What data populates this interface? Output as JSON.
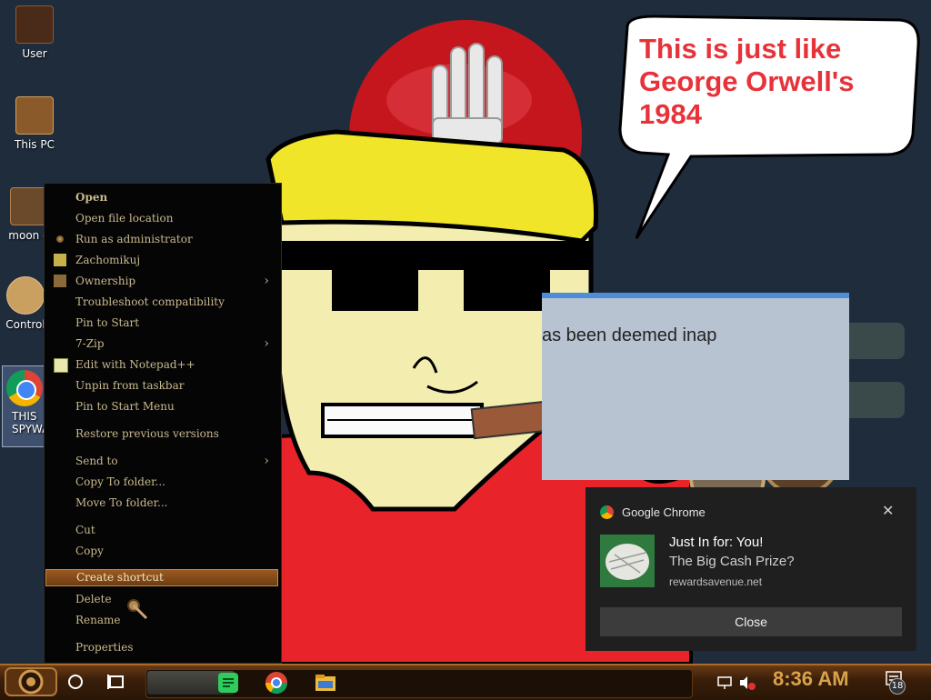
{
  "desktop": {
    "icons": [
      {
        "label": "User"
      },
      {
        "label": "This PC"
      },
      {
        "label": "moon g"
      },
      {
        "label": "Control"
      },
      {
        "label": "THIS\nSPYWA"
      }
    ]
  },
  "wallpaper": {
    "bubble_line1": "This is just like",
    "bubble_line2": "George Orwell's",
    "bubble_line3": "1984",
    "bg_window_text": "as been deemed inap"
  },
  "context_menu": {
    "items": [
      {
        "label": "Open"
      },
      {
        "label": "Open file location"
      },
      {
        "label": "Run as administrator"
      },
      {
        "label": "Zachomikuj"
      },
      {
        "label": "Ownership"
      },
      {
        "label": "Troubleshoot compatibility"
      },
      {
        "label": "Pin to Start"
      },
      {
        "label": "7-Zip"
      },
      {
        "label": "Edit with Notepad++"
      },
      {
        "label": "Unpin from taskbar"
      },
      {
        "label": "Pin to Start Menu"
      },
      {
        "label": "Restore previous versions"
      },
      {
        "label": "Send to"
      },
      {
        "label": "Copy To folder..."
      },
      {
        "label": "Move To folder..."
      },
      {
        "label": "Cut"
      },
      {
        "label": "Copy"
      },
      {
        "label": "Create shortcut"
      },
      {
        "label": "Delete"
      },
      {
        "label": "Rename"
      },
      {
        "label": "Properties"
      }
    ],
    "selected": "Create shortcut"
  },
  "toast": {
    "app_name": "Google Chrome",
    "title": "Just In for: You!",
    "body": "The Big Cash Prize?",
    "source": "rewardsavenue.net",
    "button": "Close",
    "close_glyph": "✕"
  },
  "taskbar": {
    "clock": "8:36 AM",
    "notification_count": "18",
    "pinned": [
      "spotify-icon",
      "chrome-icon",
      "file-explorer-icon"
    ]
  },
  "colors": {
    "bubble_text": "#e8323a",
    "menu_text": "#c9b98e",
    "menu_selected": "#9b5a1f",
    "clock": "#d8a24a",
    "toast_bg": "#1f1f1f"
  }
}
